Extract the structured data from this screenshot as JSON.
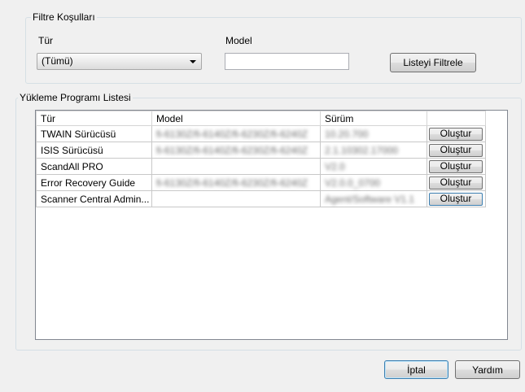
{
  "filter": {
    "legend": "Filtre Koşulları",
    "tur_label": "Tür",
    "model_label": "Model",
    "tur_selected": "(Tümü)",
    "model_value": "",
    "filter_button": "Listeyi Filtrele"
  },
  "list": {
    "legend": "Yükleme Programı Listesi",
    "columns": [
      "Tür",
      "Model",
      "Sürüm",
      ""
    ],
    "rows": [
      {
        "tur": "TWAIN Sürücüsü",
        "model": "fi-6130Z/fi-6140Z/fi-6230Z/fi-6240Z",
        "surum": "10.20.700",
        "action": "Oluştur"
      },
      {
        "tur": "ISIS Sürücüsü",
        "model": "fi-6130Z/fi-6140Z/fi-6230Z/fi-6240Z",
        "surum": "2.1.10302.17000",
        "action": "Oluştur"
      },
      {
        "tur": "ScandAll PRO",
        "model": "",
        "surum": "V2.0",
        "action": "Oluştur"
      },
      {
        "tur": "Error Recovery Guide",
        "model": "fi-6130Z/fi-6140Z/fi-6230Z/fi-6240Z",
        "surum": "V2.0.0_0700",
        "action": "Oluştur"
      },
      {
        "tur": "Scanner Central Admin...",
        "model": "",
        "surum": "Agent/Software V1.1",
        "action": "Oluştur"
      }
    ]
  },
  "footer": {
    "cancel_button": "İptal",
    "help_button": "Yardım"
  }
}
